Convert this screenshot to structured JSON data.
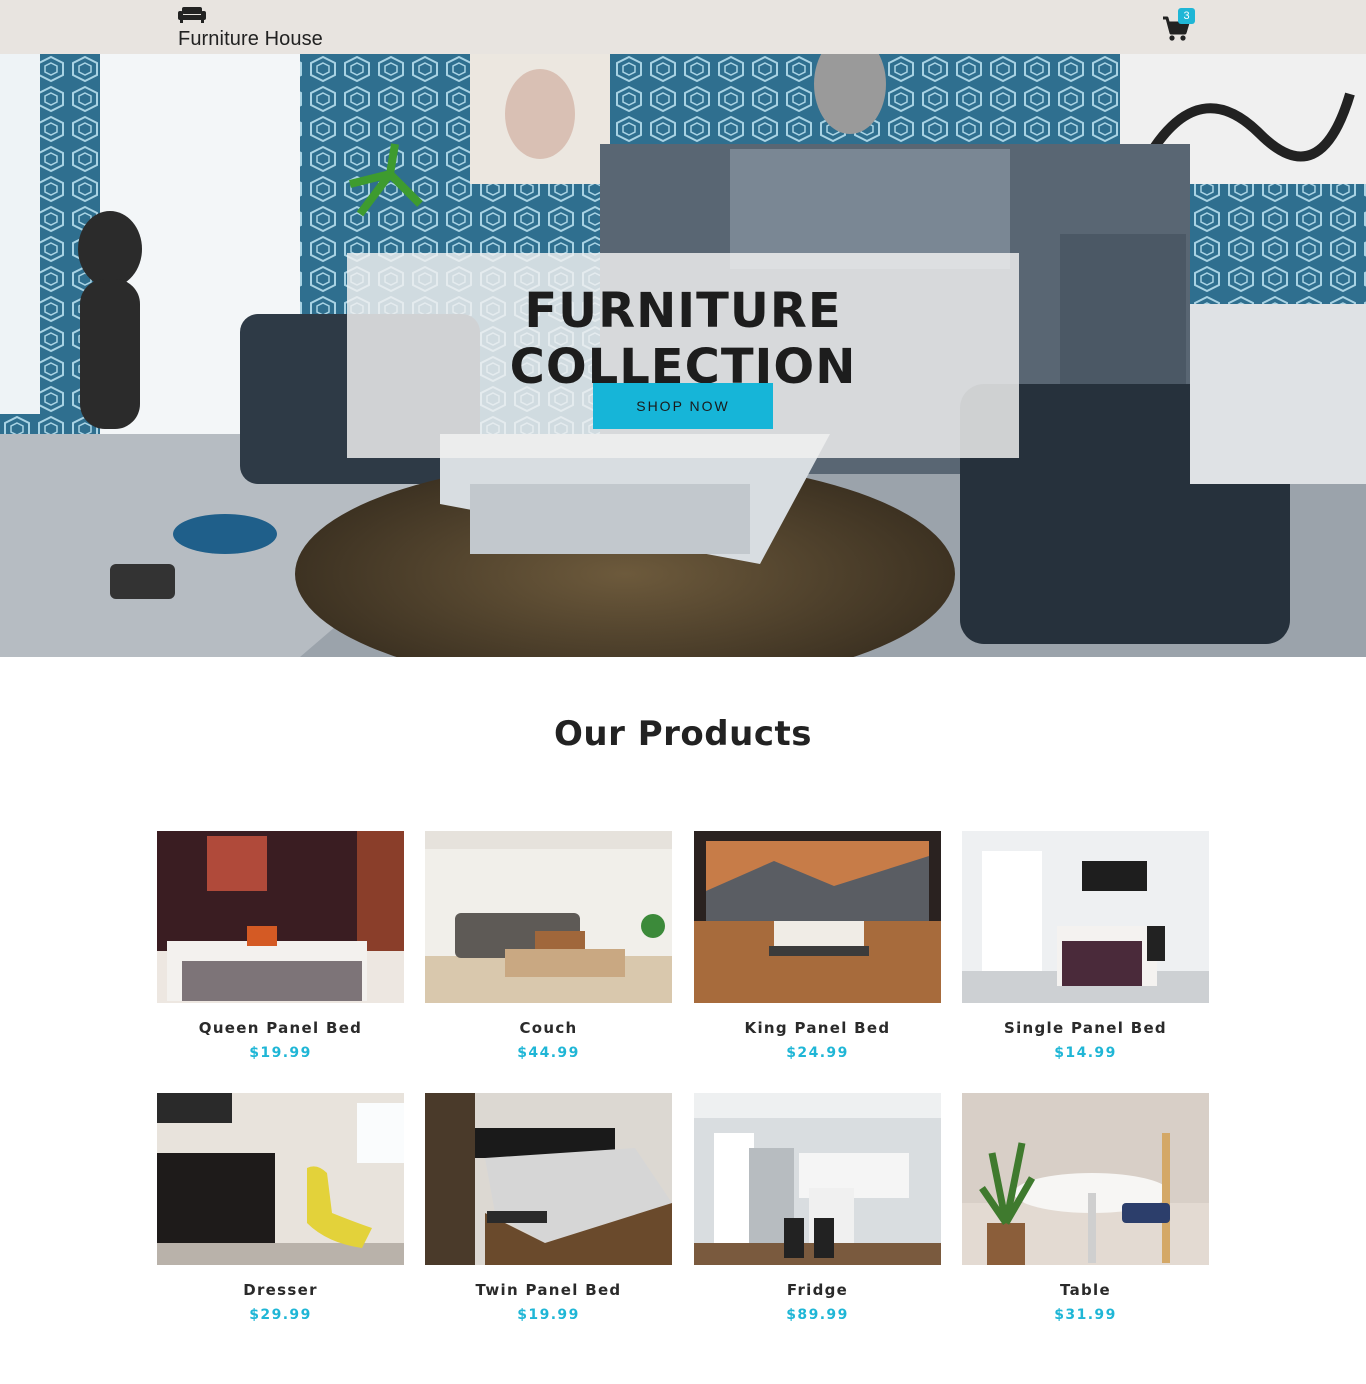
{
  "navbar": {
    "brand_name": "Furniture House",
    "brand_icon": "sofa-icon",
    "cart_icon": "cart-icon",
    "cart_count": "3"
  },
  "hero": {
    "title": "FURNITURE COLLECTION",
    "button_label": "SHOP NOW"
  },
  "products_section": {
    "title": "Our Products",
    "items": [
      {
        "name": "Queen Panel Bed",
        "price": "$19.99"
      },
      {
        "name": "Couch",
        "price": "$44.99"
      },
      {
        "name": "King Panel Bed",
        "price": "$24.99"
      },
      {
        "name": "Single Panel Bed",
        "price": "$14.99"
      },
      {
        "name": "Dresser",
        "price": "$29.99"
      },
      {
        "name": "Twin Panel Bed",
        "price": "$19.99"
      },
      {
        "name": "Fridge",
        "price": "$89.99"
      },
      {
        "name": "Table",
        "price": "$31.99"
      }
    ]
  },
  "colors": {
    "accent": "#1fb6d6",
    "navbar_bg": "#e8e4e0",
    "text_dark": "#222222"
  }
}
